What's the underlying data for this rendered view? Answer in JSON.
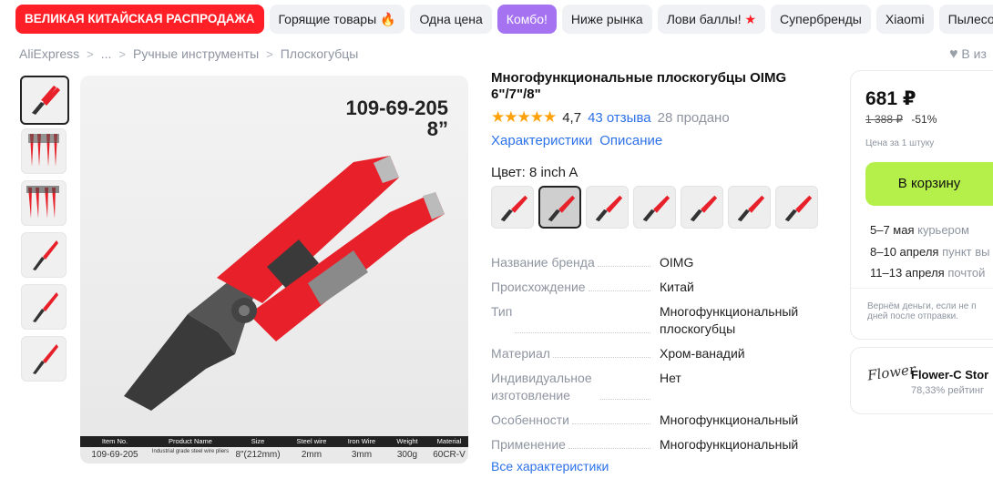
{
  "chips": [
    {
      "label": "ВЕЛИКАЯ КИТАЙСКАЯ РАСПРОДАЖА",
      "kind": "sale"
    },
    {
      "label": "Горящие товары",
      "kind": "fire"
    },
    {
      "label": "Одна цена",
      "kind": "plain"
    },
    {
      "label": "Комбо!",
      "kind": "combo"
    },
    {
      "label": "Ниже рынка",
      "kind": "plain"
    },
    {
      "label": "Лови баллы!",
      "kind": "star"
    },
    {
      "label": "Супербренды",
      "kind": "plain"
    },
    {
      "label": "Xiaomi",
      "kind": "plain"
    },
    {
      "label": "Пылесосы D",
      "kind": "plain"
    }
  ],
  "breadcrumb": [
    "AliExpress",
    "...",
    "Ручные инструменты",
    "Плоскогубцы"
  ],
  "favorite_label": "В из",
  "image": {
    "code": "109-69-205",
    "size": "8”",
    "table_headers": [
      "Item No.",
      "Product Name",
      "Size",
      "Steel wire",
      "Iron Wire",
      "Weight",
      "Material"
    ],
    "table_values": [
      "109-69-205",
      "Industrial grade steel wire pliers",
      "8\"(212mm)",
      "2mm",
      "3mm",
      "300g",
      "60CR-V"
    ]
  },
  "product": {
    "title": "Многофункциональные плоскогубцы OIMG 6\"/7\"/8\"",
    "rating": "4,7",
    "rating_value": 4.7,
    "reviews": "43 отзыва",
    "sold": "28 продано",
    "tab_chars": "Характеристики",
    "tab_desc": "Описание",
    "color_label": "Цвет: 8 inch A",
    "swatch_count": 7,
    "active_swatch": 1
  },
  "properties": [
    {
      "key": "Название бренда",
      "value": "OIMG"
    },
    {
      "key": "Происхождение",
      "value": "Китай"
    },
    {
      "key": "Тип",
      "value": "Многофункциональный плоскогубцы"
    },
    {
      "key": "Материал",
      "value": "Хром-ванадий"
    },
    {
      "key": "Индивидуальное изготовление",
      "value": "Нет"
    },
    {
      "key": "Особенности",
      "value": "Многофункциональный"
    },
    {
      "key": "Применение",
      "value": "Многофункциональный"
    }
  ],
  "all_chars_link": "Все характеристики",
  "buy": {
    "price": "681 ₽",
    "old_price": "1 388 ₽",
    "discount": "-51%",
    "per_unit": "Цена за 1 штуку",
    "cart_button": "В корзину",
    "delivery": [
      {
        "date": "5–7 мая",
        "method": "курьером"
      },
      {
        "date": "8–10 апреля",
        "method": "пункт вы"
      },
      {
        "date": "11–13 апреля",
        "method": "почтой"
      }
    ],
    "refund_line1": "Вернём деньги, если не п",
    "refund_line2": "дней после отправки."
  },
  "store": {
    "logo_text": "Flower",
    "name": "Flower-C Stor",
    "rating": "78,33% рейтинг"
  },
  "colors": {
    "sale_red": "#ff1f27",
    "combo_purple": "#a572f2",
    "cart_green": "#b5ef4a",
    "link_blue": "#2d72e8",
    "star_orange": "#ffa10a",
    "pliers_red": "#e8202a"
  }
}
